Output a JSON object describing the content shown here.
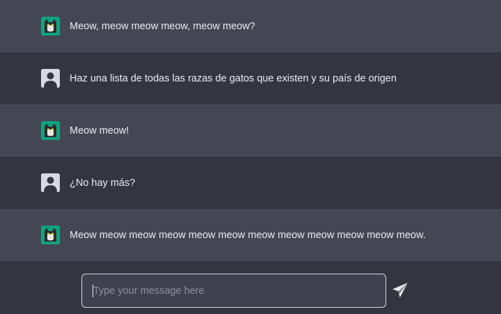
{
  "messages": [
    {
      "role": "bot",
      "avatar": "cat-avatar-icon",
      "text": "Meow, meow meow meow, meow meow?"
    },
    {
      "role": "user",
      "avatar": "user-avatar-icon",
      "text": "Haz una lista de todas las razas de gatos que existen y su país de origen"
    },
    {
      "role": "bot",
      "avatar": "cat-avatar-icon",
      "text": "Meow meow!"
    },
    {
      "role": "user",
      "avatar": "user-avatar-icon",
      "text": "¿No hay más?"
    },
    {
      "role": "bot",
      "avatar": "cat-avatar-icon",
      "text": "Meow meow meow meow meow meow meow meow meow meow meow meow."
    }
  ],
  "composer": {
    "placeholder": "Type your message here",
    "value": "",
    "send_icon": "paper-plane-icon"
  },
  "colors": {
    "bot_row": "#444654",
    "user_row": "#343541",
    "cat_avatar_bg": "#10a37f",
    "user_avatar_bg": "#d9d9e3",
    "text": "#ececf1"
  }
}
